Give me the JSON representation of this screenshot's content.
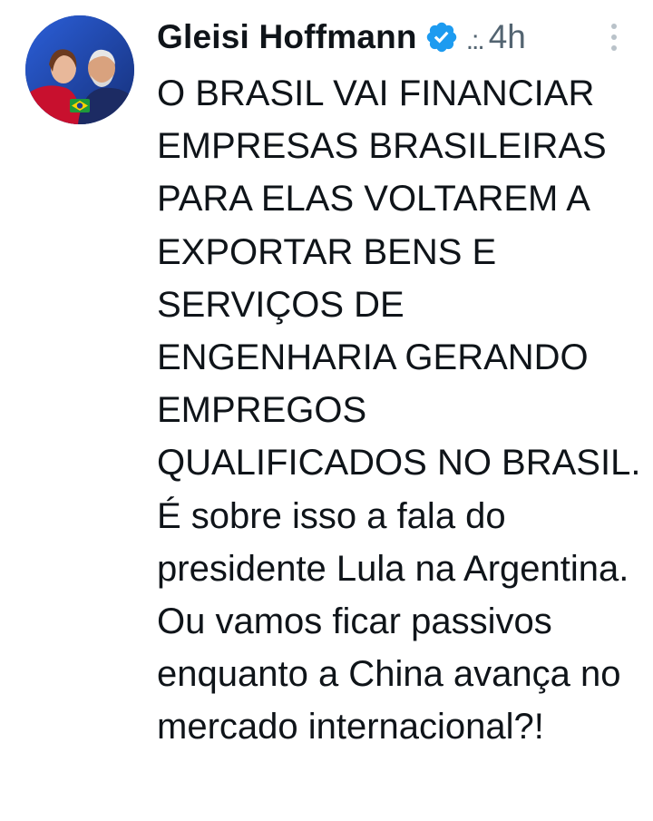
{
  "author": {
    "display_name": "Gleisi Hoffmann",
    "verified": true,
    "avatar_icon": "profile-photo"
  },
  "meta": {
    "separator": ".:.",
    "time": "4h"
  },
  "tweet": {
    "text": "O BRASIL VAI FINANCIAR EMPRESAS BRASILEIRAS PARA ELAS VOLTAREM A EXPORTAR BENS E SERVIÇOS DE ENGENHARIA GERANDO EMPREGOS QUALIFICADOS NO BRASIL. É sobre isso a fala do presidente Lula na Argentina. Ou vamos ficar passivos enquanto a China avança no mercado internacional?!"
  },
  "colors": {
    "text": "#0f1419",
    "secondary": "#536471",
    "verified_blue": "#1d9bf0",
    "background": "#ffffff"
  }
}
